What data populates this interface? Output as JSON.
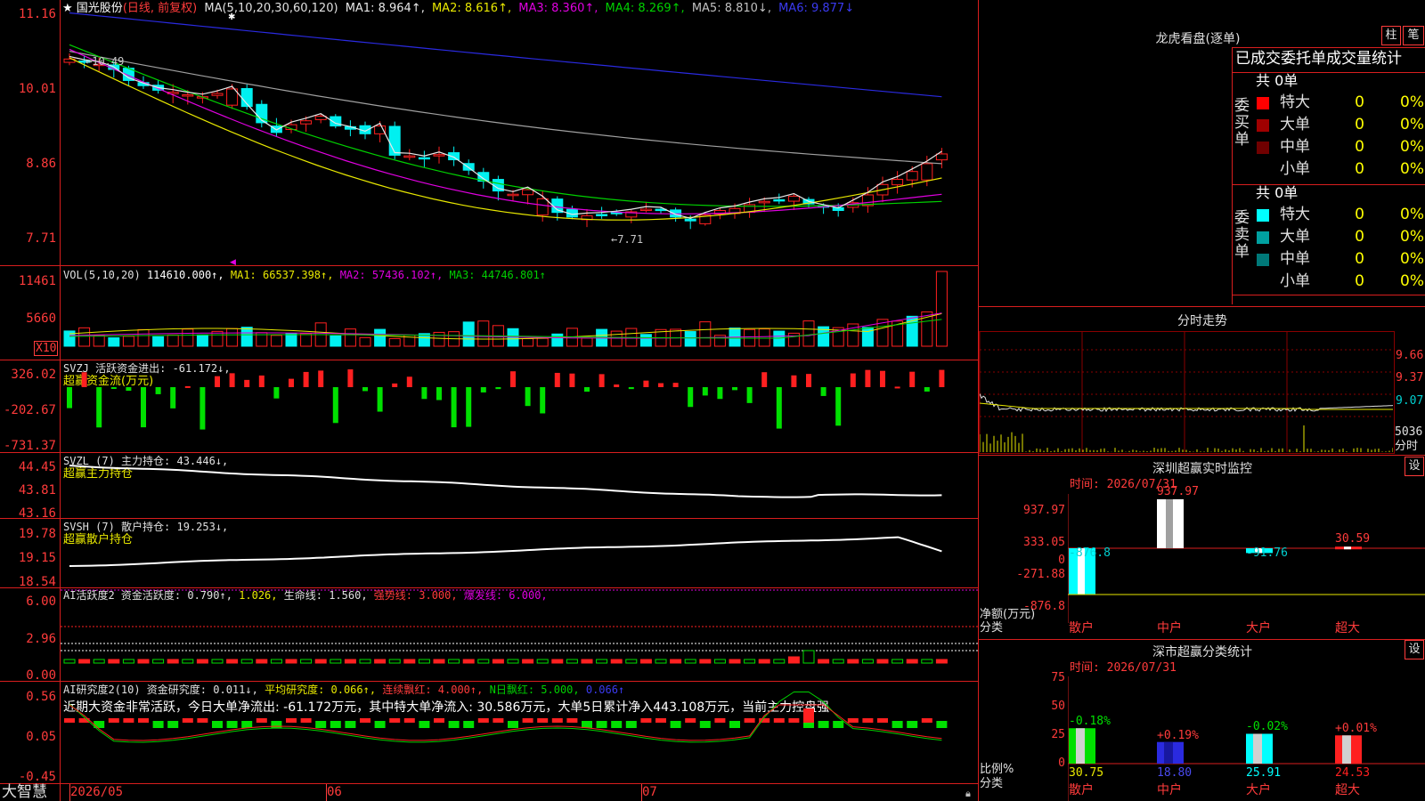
{
  "colors": {
    "up": "#ff2020",
    "down": "#00f0f0",
    "frame": "#d81e1e",
    "ma1": "#e8e8e8",
    "ma2": "#e8e800",
    "ma3": "#e000e0",
    "ma4": "#00d000",
    "ma5": "#a0a0a0",
    "ma6": "#2a2ae0"
  },
  "main": {
    "title": "国光股份",
    "title_note": "(日线, 前复权)",
    "ma_label": "MA(5,10,20,30,60,120)",
    "ma1": "MA1: 8.964↑,",
    "ma2": "MA2: 8.616↑,",
    "ma3": "MA3: 8.360↑,",
    "ma4": "MA4: 8.269↑,",
    "ma5": "MA5: 8.810↓,",
    "ma6": "MA6: 9.877↓",
    "yticks": [
      "11.16",
      "10.01",
      "8.86",
      "7.71"
    ],
    "high_mark": "10.49",
    "low_mark": "7.71"
  },
  "vol": {
    "label": "VOL(5,10,20)",
    "value": "114610.000↑,",
    "ma1": "MA1: 66537.398↑,",
    "ma2": "MA2: 57436.102↑,",
    "ma3": "MA3: 44746.801↑",
    "yticks": [
      "11461",
      "5660"
    ],
    "unit": "X10"
  },
  "svzj": {
    "label": "SVZJ  活跃资金进出: -61.172↓,",
    "sub": "超赢资金流(万元)",
    "yticks": [
      "326.02",
      "-202.67",
      "-731.37"
    ]
  },
  "svzl": {
    "label": "SVZL (7) 主力持仓: 43.446↓,",
    "sub": "超赢主力持仓",
    "yticks": [
      "44.45",
      "43.81",
      "43.16"
    ]
  },
  "svsh": {
    "label": "SVSH (7) 散户持仓: 19.253↓,",
    "sub": "超赢散户持仓",
    "yticks": [
      "19.78",
      "19.15",
      "18.54"
    ]
  },
  "ai1": {
    "label_a": "AI活跃度2 资金活跃度: 0.790↑,",
    "label_b": "1.026,",
    "label_c": "生命线: 1.560,",
    "label_d": "强势线: 3.000,",
    "label_e": "爆发线: 6.000,",
    "yticks": [
      "6.00",
      "2.96",
      "0.00"
    ]
  },
  "ai2": {
    "label_a": "AI研究度2(10) 资金研究度: 0.011↓,",
    "label_b": "平均研究度: 0.066↑,",
    "label_c": "连续飘红: 4.000↑,",
    "label_d": "N日飘红: 5.000,",
    "label_e": "0.066↑",
    "summary": "近期大资金非常活跃，今日大单净流出: -61.172万元，其中特大单净流入: 30.586万元，大单5日累计净入443.108万元，当前主力控盘强",
    "yticks": [
      "0.56",
      "0.05",
      "-0.45"
    ]
  },
  "xaxis": {
    "brand": "大智慧",
    "labels": [
      "2026/05",
      "06",
      "07"
    ]
  },
  "dragon": {
    "title": "龙虎看盘(逐单)",
    "btn_bar": "柱",
    "btn_pen": "笔",
    "tabs": "已成交委托单成交量统计",
    "buy_label": "委买单",
    "sell_label": "委卖单",
    "buy_total": "共 0单",
    "sell_total": "共 0单",
    "buy": [
      {
        "name": "特大",
        "count": "0",
        "pct": "0%",
        "color": "#ff0000"
      },
      {
        "name": "大单",
        "count": "0",
        "pct": "0%",
        "color": "#a00000"
      },
      {
        "name": "中单",
        "count": "0",
        "pct": "0%",
        "color": "#700000"
      },
      {
        "name": "小单",
        "count": "0",
        "pct": "0%",
        "color": "#000000"
      }
    ],
    "sell": [
      {
        "name": "特大",
        "count": "0",
        "pct": "0%",
        "color": "#00ffff"
      },
      {
        "name": "大单",
        "count": "0",
        "pct": "0%",
        "color": "#00a0a0"
      },
      {
        "name": "中单",
        "count": "0",
        "pct": "0%",
        "color": "#007878"
      },
      {
        "name": "小单",
        "count": "0",
        "pct": "0%",
        "color": "#000000"
      }
    ]
  },
  "intraday": {
    "title": "分时走势",
    "yticks": [
      "9.66",
      "9.37",
      "9.07"
    ],
    "vol_tick": "5036",
    "vol_unit": "分时"
  },
  "monitor": {
    "title": "深圳超赢实时监控",
    "btn": "设",
    "time": "时间: 2026/07/31",
    "yticks": [
      "937.97",
      "333.05",
      "0",
      "-271.88",
      "-876.8"
    ],
    "ylabel_a": "净额(万元)",
    "ylabel_b": "分类",
    "cats": [
      "散户",
      "中户",
      "大户",
      "超大"
    ],
    "values": [
      "-876.8",
      "937.97",
      "-91.76",
      "30.59"
    ]
  },
  "classify": {
    "title": "深市超赢分类统计",
    "btn": "设",
    "time": "时间: 2026/07/31",
    "yticks": [
      "75",
      "50",
      "25",
      "0"
    ],
    "ylabel_a": "比例%",
    "ylabel_b": "分类",
    "cats": [
      "散户",
      "中户",
      "大户",
      "超大"
    ],
    "pcts": [
      "-0.18%",
      "+0.19%",
      "-0.02%",
      "+0.01%"
    ],
    "values": [
      "30.75",
      "18.80",
      "25.91",
      "24.53"
    ]
  }
}
